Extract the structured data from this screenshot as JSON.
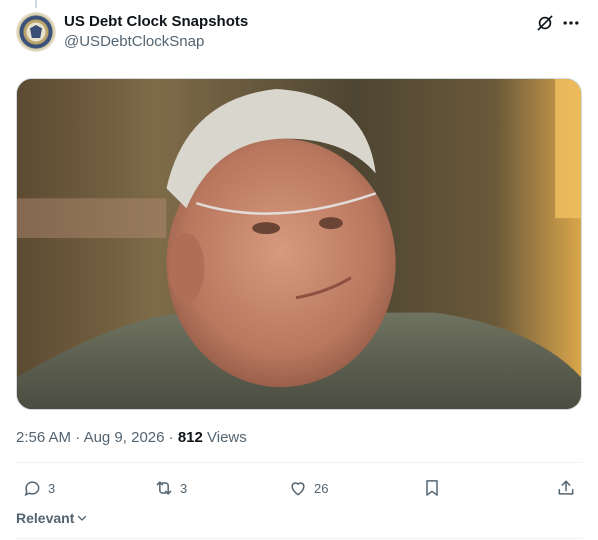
{
  "post": {
    "display_name": "US Debt Clock Snapshots",
    "handle": "@USDebtClockSnap",
    "time": "2:56 AM",
    "date": "Aug 9, 2026",
    "views_count": "812",
    "views_label": "Views",
    "media": {
      "description_icon": "photo",
      "accent": "#d8a64a"
    }
  },
  "actions": {
    "replies": "3",
    "reposts": "3",
    "likes": "26"
  },
  "replies_sort": {
    "label": "Relevant"
  },
  "colors": {
    "text_primary": "#0f1419",
    "text_secondary": "#536471",
    "divider": "#eff3f4"
  },
  "icons": [
    "grok-icon",
    "more-icon",
    "reply-icon",
    "repost-icon",
    "like-icon",
    "bookmark-icon",
    "share-icon",
    "chevron-down-icon"
  ]
}
